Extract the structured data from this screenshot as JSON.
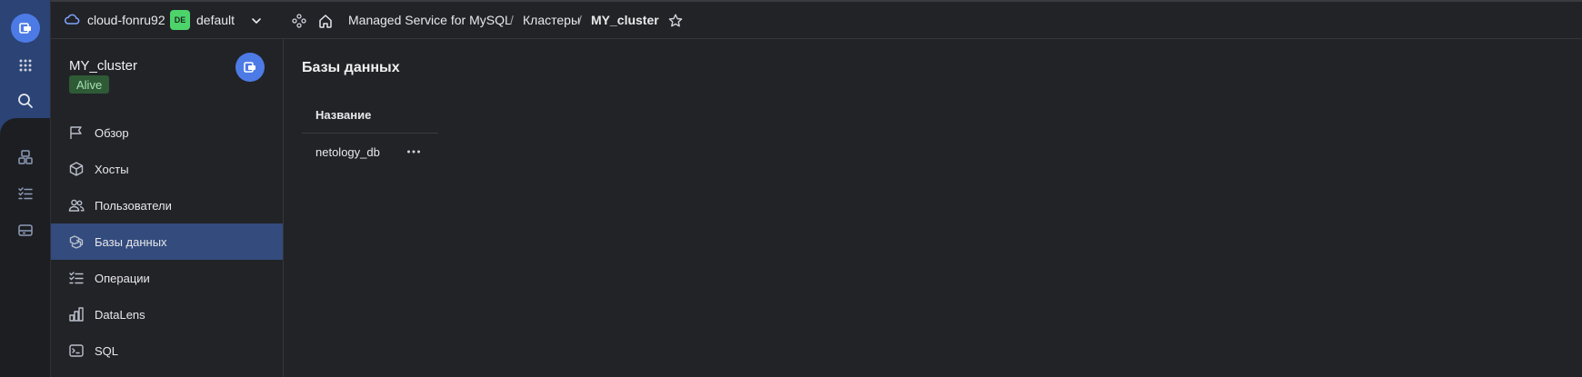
{
  "app": {
    "accent_color": "#4d7be6",
    "rail": {
      "logo_icon": "mysql-service-icon",
      "buttons": [
        "apps-grid-icon",
        "search-icon",
        "services-icon",
        "operations-icon",
        "storage-icon"
      ]
    }
  },
  "topbar": {
    "cloud_name": "cloud-fonru92",
    "folder_badge": "DE",
    "folder_name": "default",
    "breadcrumbs": [
      {
        "label": "Managed Service for MySQL"
      },
      {
        "label": "Кластеры"
      },
      {
        "label": "MY_cluster"
      }
    ],
    "separator": "/"
  },
  "cluster": {
    "name": "MY_cluster",
    "status": "Alive",
    "status_color": "#2e5a36"
  },
  "nav": {
    "items": [
      {
        "label": "Обзор",
        "icon": "flag-icon",
        "active": false
      },
      {
        "label": "Хосты",
        "icon": "cube-icon",
        "active": false
      },
      {
        "label": "Пользователи",
        "icon": "users-icon",
        "active": false
      },
      {
        "label": "Базы данных",
        "icon": "databases-icon",
        "active": true
      },
      {
        "label": "Операции",
        "icon": "operations-list-icon",
        "active": false
      },
      {
        "label": "DataLens",
        "icon": "chart-icon",
        "active": false
      },
      {
        "label": "SQL",
        "icon": "terminal-icon",
        "active": false
      }
    ]
  },
  "main": {
    "title": "Базы данных",
    "table": {
      "columns": [
        "Название"
      ],
      "rows": [
        {
          "name": "netology_db"
        }
      ]
    }
  }
}
